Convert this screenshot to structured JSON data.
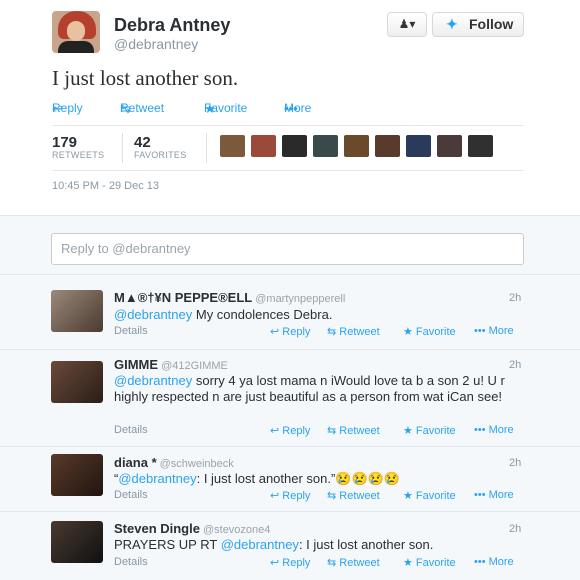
{
  "tweet": {
    "author_name": "Debra Antney",
    "author_handle": "@debrantney",
    "text": "I just lost another son.",
    "follow_label": "Follow",
    "user_menu_icon": "person-dropdown-icon",
    "actions": {
      "reply": "Reply",
      "retweet": "Retweet",
      "favorite": "Favorite",
      "more": "More"
    },
    "stats": {
      "retweets_count": "179",
      "retweets_label": "RETWEETS",
      "favorites_count": "42",
      "favorites_label": "FAVORITES"
    },
    "timestamp": "10:45 PM - 29 Dec 13"
  },
  "favoriter_avatars": [
    "#7a5a3a",
    "#9b4a3a",
    "#2a2a2a",
    "#3a4a4a",
    "#6a4a2a",
    "#5a3a2a",
    "#2a3a5a",
    "#4a3a3a",
    "#303030"
  ],
  "reply_box": {
    "placeholder": "Reply to @debrantney"
  },
  "replies": [
    {
      "name": "M▲®†¥N PEPPE®ELL",
      "handle": "@martynpepperell",
      "time": "2h",
      "mention": "@debrantney",
      "text": " My condolences Debra.",
      "details": "Details"
    },
    {
      "name": "GIMME",
      "handle": "@412GIMME",
      "time": "2h",
      "mention": "@debrantney",
      "text": " sorry 4 ya lost mama n iWould love ta b a son 2 u! U r highly respected n are just beautiful as a person from wat iCan see!",
      "details": "Details"
    },
    {
      "name": "diana *",
      "handle": "@schweinbeck",
      "time": "2h",
      "prefix": "“",
      "mention": "@debrantney",
      "text": ": I just lost another son.”😢😢😢😢",
      "details": "Details"
    },
    {
      "name": "Steven Dingle",
      "handle": "@stevozone4",
      "time": "2h",
      "prefix": "PRAYERS UP RT ",
      "mention": "@debrantney",
      "text": ": I just lost another son.",
      "details": "Details"
    }
  ],
  "colors": {
    "link": "#2aa3ef",
    "text": "#292f33",
    "muted": "#8899a6",
    "background": "#f5f8fa"
  }
}
